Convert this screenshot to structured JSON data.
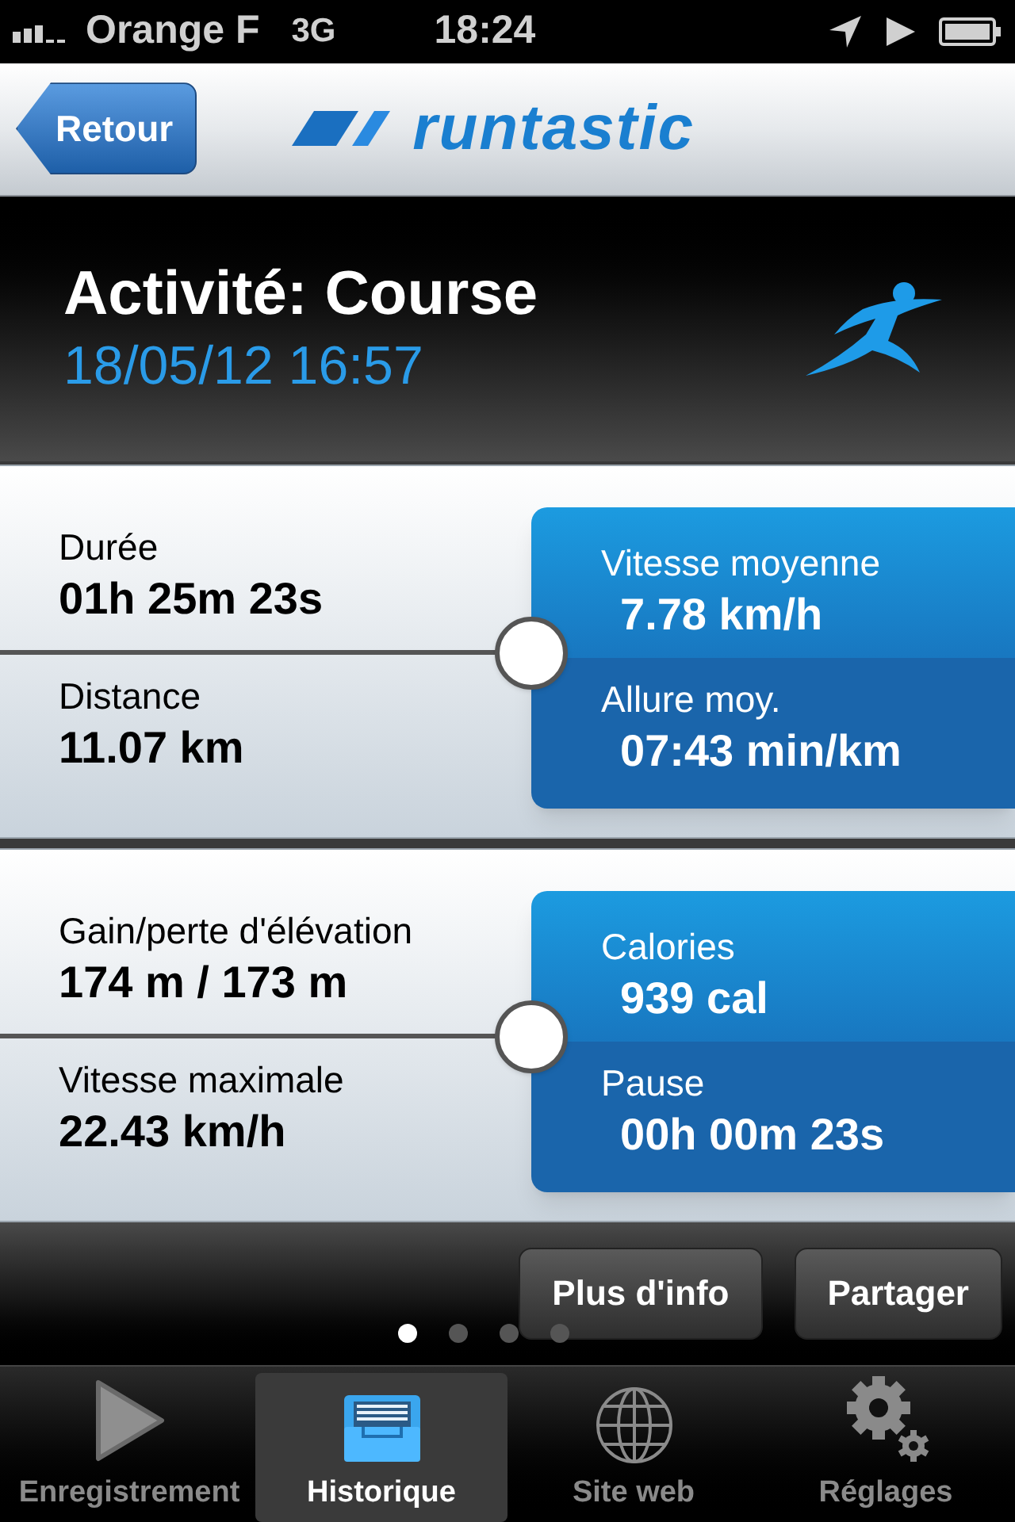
{
  "status_bar": {
    "carrier": "Orange F",
    "network": "3G",
    "time": "18:24"
  },
  "nav": {
    "back": "Retour",
    "logo": "runtastic"
  },
  "header": {
    "title": "Activité: Course",
    "date": "18/05/12 16:57"
  },
  "cards": [
    {
      "left": [
        {
          "label": "Durée",
          "value": "01h 25m 23s"
        },
        {
          "label": "Distance",
          "value": "11.07 km"
        }
      ],
      "right": [
        {
          "label": "Vitesse moyenne",
          "value": "7.78 km/h"
        },
        {
          "label": "Allure moy.",
          "value": "07:43 min/km"
        }
      ]
    },
    {
      "left": [
        {
          "label": "Gain/perte d'élévation",
          "value": "174 m / 173 m"
        },
        {
          "label": "Vitesse maximale",
          "value": "22.43 km/h"
        }
      ],
      "right": [
        {
          "label": "Calories",
          "value": "939 cal"
        },
        {
          "label": "Pause",
          "value": "00h 00m 23s"
        }
      ]
    }
  ],
  "actions": [
    "Plus d'info",
    "Partager"
  ],
  "pages": [
    {
      "selected": true
    },
    {
      "selected": false
    },
    {
      "selected": false
    },
    {
      "selected": false
    }
  ],
  "tabs": [
    {
      "label": "Enregistrement",
      "kind": "record",
      "selected": false
    },
    {
      "label": "Historique",
      "kind": "history",
      "selected": true
    },
    {
      "label": "Site web",
      "kind": "website",
      "selected": false
    },
    {
      "label": "Réglages",
      "kind": "settings",
      "selected": false
    }
  ]
}
